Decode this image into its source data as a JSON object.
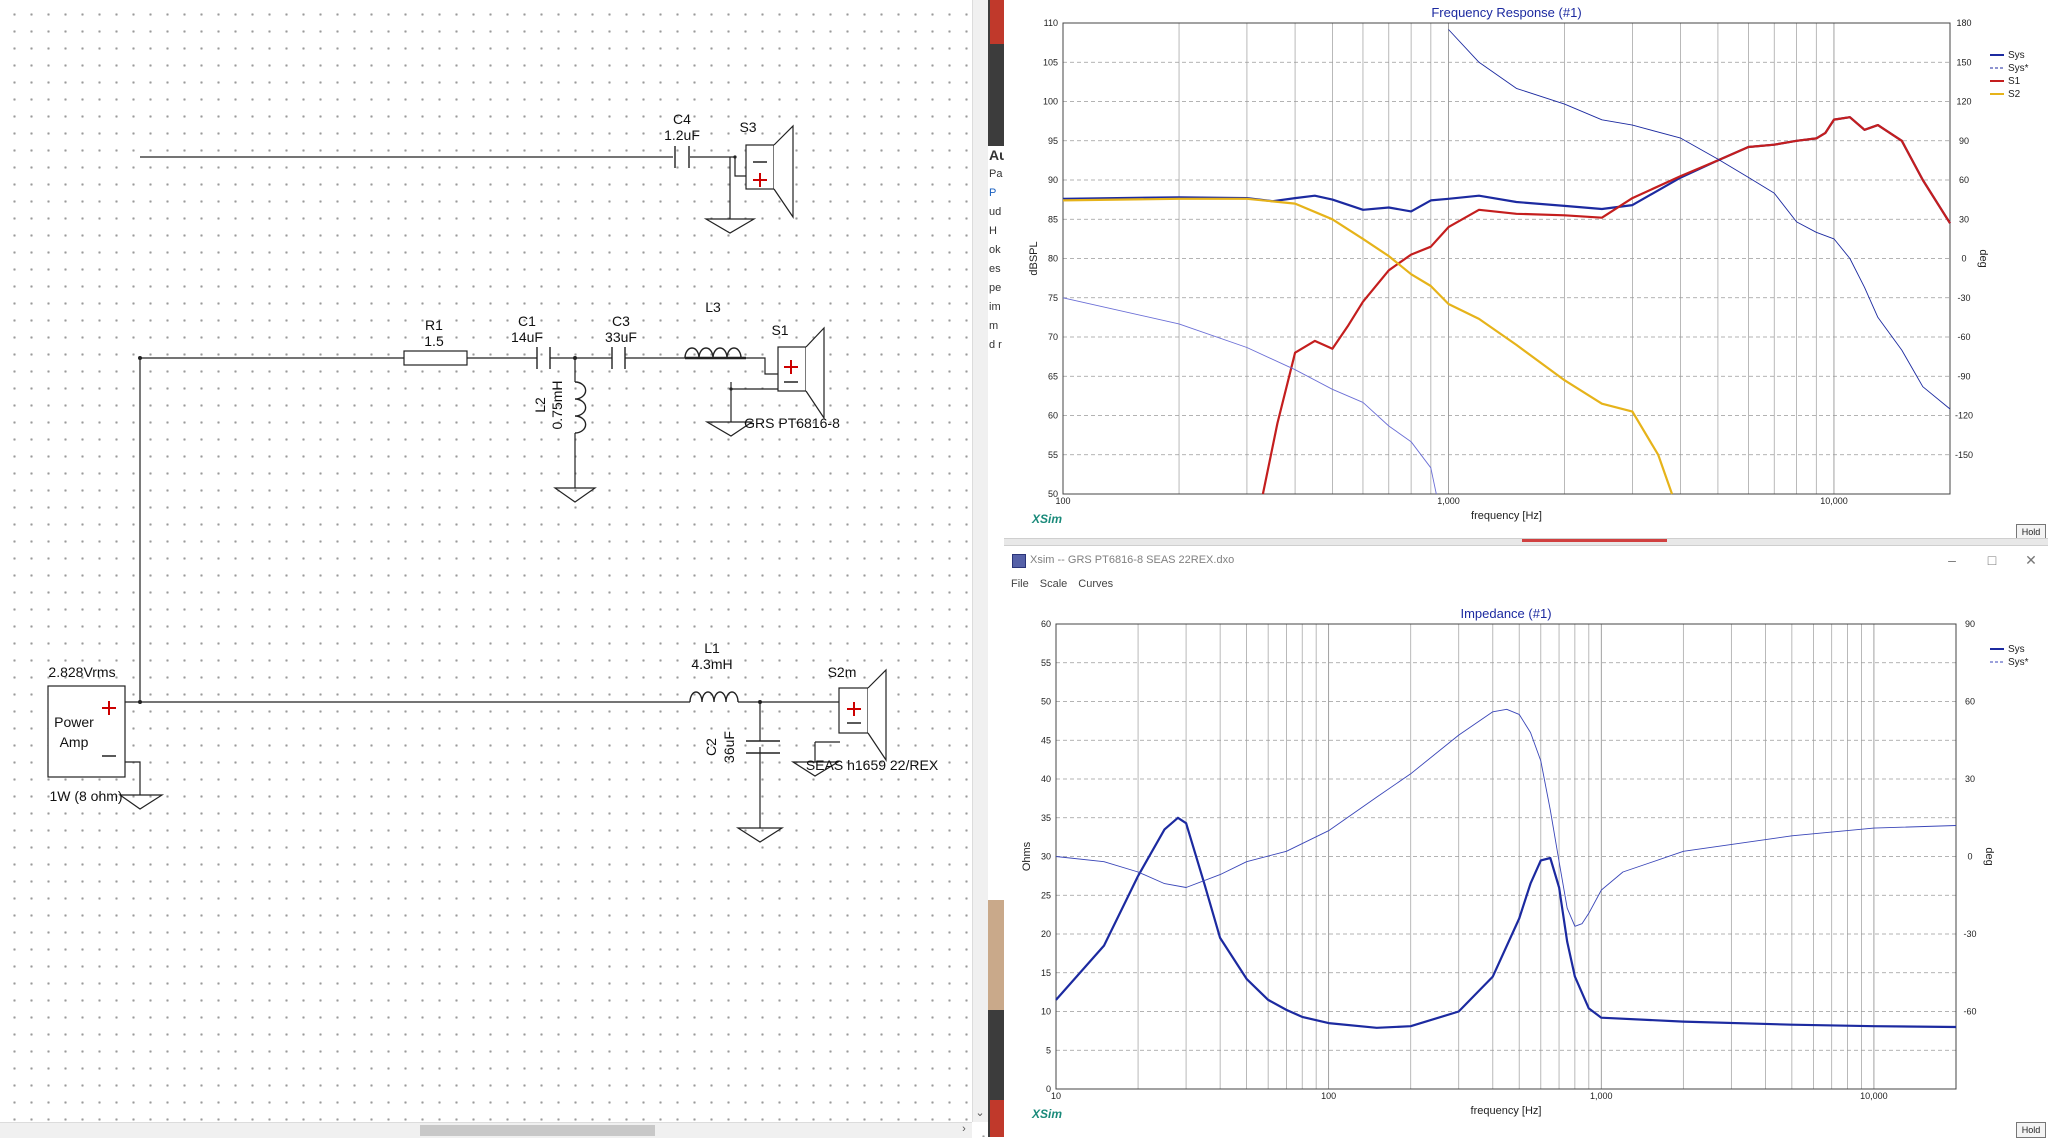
{
  "schematic": {
    "components": {
      "c4": {
        "name": "C4",
        "value": "1.2uF"
      },
      "s3": {
        "name": "S3"
      },
      "r1": {
        "name": "R1",
        "value": "1.5"
      },
      "c1": {
        "name": "C1",
        "value": "14uF"
      },
      "c3": {
        "name": "C3",
        "value": "33uF"
      },
      "l3": {
        "name": "L3"
      },
      "s1": {
        "name": "S1",
        "driver": "GRS PT6816-8"
      },
      "l2": {
        "name": "L2",
        "value": "0.75mH"
      },
      "l1": {
        "name": "L1",
        "value": "4.3mH"
      },
      "c2": {
        "name": "C2",
        "value": "36uF"
      },
      "s2m": {
        "name": "S2m",
        "driver": "SEAS h1659 22/REX"
      },
      "amp": {
        "voltage": "2.828Vrms",
        "label_line1": "Power",
        "label_line2": "Amp",
        "power": "1W (8 ohm)"
      }
    }
  },
  "background_app": {
    "doc_snippets": [
      "Au",
      "Pa",
      "P",
      "ud",
      "H",
      "ok",
      "",
      "es",
      "",
      "pe",
      "im",
      "m",
      "d r"
    ]
  },
  "freq_window": {
    "hold": "Hold",
    "chart": {
      "title": "Frequency Response (#1)",
      "xlabel": "frequency [Hz]",
      "ylabel_left": "dBSPL",
      "ylabel_right": "deg",
      "brand": "XSim",
      "legend": [
        "Sys",
        "Sys*",
        "S1",
        "S2"
      ],
      "colors": {
        "Sys": "#1c2aa0",
        "Sys*": "#1c2aa0",
        "S1": "#c41e1e",
        "S2": "#e6b31a",
        "phase": "#6b6fd6"
      },
      "x_ticks": [
        "100",
        "1,000",
        "10,000"
      ],
      "y_ticks": [
        "50",
        "55",
        "60",
        "65",
        "70",
        "75",
        "80",
        "85",
        "90",
        "95",
        "100",
        "105",
        "110"
      ],
      "y2_ticks": [
        "-150",
        "-120",
        "-90",
        "-60",
        "-30",
        "0",
        "30",
        "60",
        "90",
        "120",
        "150",
        "180"
      ]
    }
  },
  "imp_window": {
    "title": "Xsim -- GRS PT6816-8 SEAS 22REX.dxo",
    "menu": [
      "File",
      "Scale",
      "Curves"
    ],
    "hold": "Hold",
    "chart": {
      "title": "Impedance (#1)",
      "xlabel": "frequency [Hz]",
      "ylabel_left": "Ohms",
      "ylabel_right": "deg",
      "brand": "XSim",
      "legend": [
        "Sys",
        "Sys*"
      ],
      "colors": {
        "Sys": "#1c2aa0",
        "Sys*": "#3a46b8",
        "phase": "#6b6fd6"
      },
      "x_ticks": [
        "10",
        "100",
        "1,000",
        "10,000"
      ],
      "y_ticks": [
        "0",
        "5",
        "10",
        "15",
        "20",
        "25",
        "30",
        "35",
        "40",
        "45",
        "50",
        "55",
        "60"
      ],
      "y2_ticks": [
        "-60",
        "-30",
        "0",
        "30",
        "60",
        "90"
      ]
    }
  },
  "chart_data": [
    {
      "type": "line",
      "title": "Frequency Response (#1)",
      "xlabel": "frequency [Hz]",
      "ylabel": "dBSPL",
      "y2label": "deg",
      "xscale": "log",
      "xlim": [
        100,
        20000
      ],
      "ylim": [
        50,
        110
      ],
      "y2lim": [
        -180,
        180
      ],
      "grid": true,
      "legend": "top-right",
      "series": [
        {
          "name": "Sys",
          "axis": "left",
          "x": [
            100,
            200,
            300,
            350,
            400,
            450,
            500,
            600,
            700,
            800,
            900,
            1000,
            1200,
            1500,
            2000,
            2500,
            3000,
            4000,
            5000,
            6000,
            7000,
            8000,
            9000,
            9500,
            10000,
            11000,
            12000,
            13000,
            15000,
            17000,
            20000
          ],
          "y": [
            87.6,
            87.8,
            87.7,
            87.3,
            87.7,
            88,
            87.5,
            86.2,
            86.5,
            86.0,
            87.4,
            87.6,
            88.0,
            87.2,
            86.7,
            86.3,
            86.8,
            90.3,
            92.5,
            94.2,
            94.5,
            95,
            95.3,
            96,
            97.7,
            98,
            96.4,
            97,
            95,
            90,
            84.5
          ]
        },
        {
          "name": "S1",
          "axis": "left",
          "x": [
            330,
            360,
            400,
            450,
            500,
            550,
            600,
            700,
            800,
            900,
            1000,
            1200,
            1500,
            2000,
            2500,
            3000,
            4000,
            5000,
            6000,
            7000,
            8000,
            9000,
            9500,
            10000,
            11000,
            12000,
            13000,
            15000,
            17000,
            20000
          ],
          "y": [
            50,
            59,
            68,
            69.5,
            68.5,
            71.5,
            74.5,
            78.5,
            80.5,
            81.5,
            84.0,
            86.2,
            85.7,
            85.5,
            85.2,
            87.7,
            90.5,
            92.5,
            94.2,
            94.5,
            95,
            95.3,
            96,
            97.7,
            98,
            96.4,
            97,
            95,
            90,
            84.5
          ]
        },
        {
          "name": "S2",
          "axis": "left",
          "x": [
            100,
            200,
            300,
            400,
            500,
            600,
            700,
            800,
            900,
            1000,
            1200,
            1500,
            2000,
            2500,
            3000,
            3500,
            3800
          ],
          "y": [
            87.4,
            87.6,
            87.6,
            87.0,
            85.0,
            82.5,
            80.3,
            78.0,
            76.5,
            74.2,
            72.3,
            69.0,
            64.5,
            61.5,
            60.5,
            55.0,
            50.0
          ]
        },
        {
          "name": "phase",
          "axis": "right",
          "x": [
            100,
            200,
            300,
            400,
            500,
            600,
            700,
            800,
            900,
            930
          ],
          "y": [
            -30,
            -50,
            -68,
            -85,
            -100,
            -110,
            -128,
            -140,
            -160,
            -180
          ]
        },
        {
          "name": "Sys*",
          "axis": "right",
          "x": [
            1000,
            1200,
            1500,
            2000,
            2500,
            3000,
            4000,
            5000,
            6000,
            7000,
            8000,
            9000,
            10000,
            11000,
            12000,
            13000,
            15000,
            17000,
            20000
          ],
          "y": [
            175,
            150,
            130,
            118,
            106,
            102,
            92,
            76,
            62,
            50,
            28,
            20,
            15,
            0,
            -22,
            -45,
            -70,
            -98,
            -115
          ]
        }
      ]
    },
    {
      "type": "line",
      "title": "Impedance (#1)",
      "xlabel": "frequency [Hz]",
      "ylabel": "Ohms",
      "y2label": "deg",
      "xscale": "log",
      "xlim": [
        10,
        20000
      ],
      "ylim": [
        0,
        60
      ],
      "y2lim": [
        -90,
        90
      ],
      "grid": true,
      "legend": "top-right",
      "series": [
        {
          "name": "Sys",
          "axis": "left",
          "x": [
            10,
            15,
            20,
            25,
            28,
            30,
            35,
            40,
            50,
            60,
            70,
            80,
            100,
            150,
            200,
            300,
            400,
            500,
            550,
            600,
            650,
            700,
            750,
            800,
            900,
            1000,
            2000,
            5000,
            10000,
            20000
          ],
          "y": [
            11.5,
            18.5,
            27.5,
            33.5,
            35,
            34.3,
            26.5,
            19.5,
            14.2,
            11.5,
            10.2,
            9.3,
            8.5,
            7.9,
            8.1,
            10,
            14.5,
            22,
            26.5,
            29.5,
            29.8,
            26,
            19,
            14.5,
            10.4,
            9.2,
            8.7,
            8.3,
            8.1,
            8.0
          ]
        },
        {
          "name": "Sys*",
          "axis": "right",
          "x": [
            10,
            15,
            20,
            25,
            30,
            40,
            50,
            70,
            100,
            150,
            200,
            300,
            400,
            450,
            500,
            550,
            600,
            650,
            700,
            750,
            800,
            850,
            900,
            1000,
            1200,
            1500,
            2000,
            5000,
            10000,
            20000
          ],
          "y": [
            0,
            -2,
            -6,
            -10.5,
            -12,
            -7,
            -2,
            2,
            10,
            23,
            32,
            47,
            56,
            57,
            55,
            48,
            37,
            18,
            -2,
            -20,
            -27,
            -26,
            -22,
            -13,
            -6,
            -2.5,
            2,
            8,
            11,
            12
          ]
        }
      ]
    }
  ]
}
